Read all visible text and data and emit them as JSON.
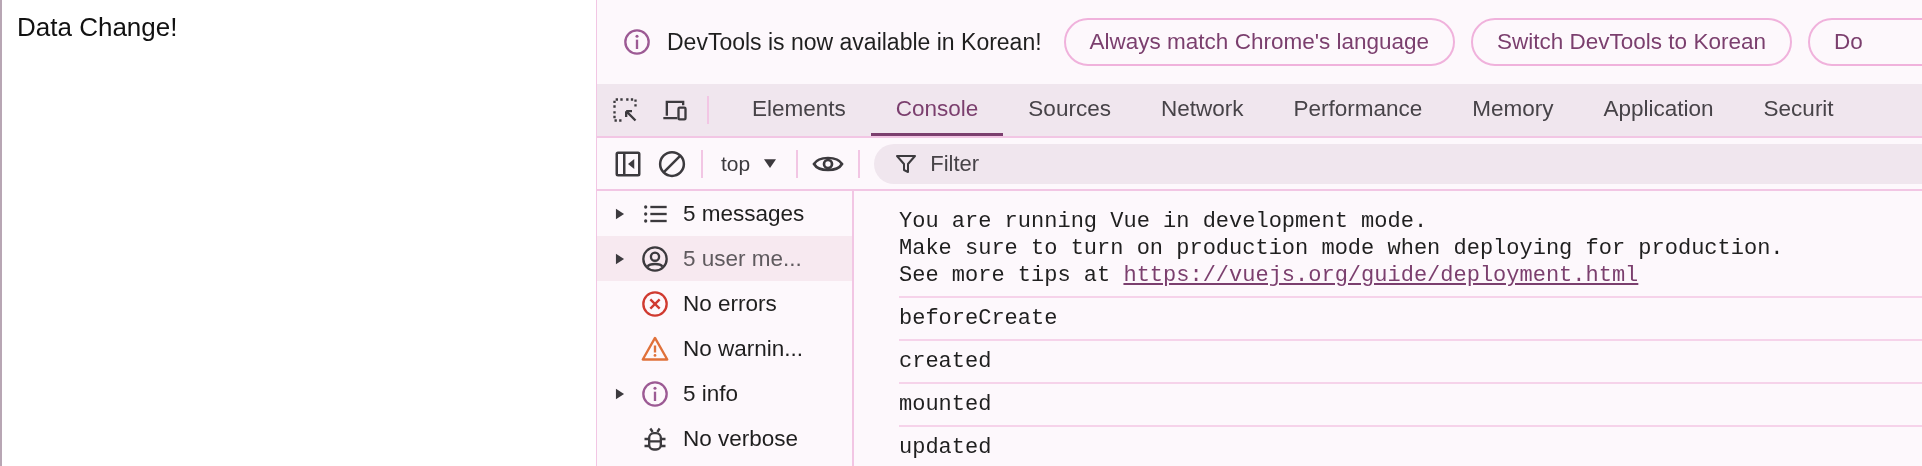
{
  "page": {
    "heading": "Data Change!"
  },
  "infobar": {
    "message": "DevTools is now available in Korean!",
    "buttons": [
      "Always match Chrome's language",
      "Switch DevTools to Korean",
      "Do"
    ]
  },
  "tabs": [
    {
      "label": "Elements",
      "selected": false
    },
    {
      "label": "Console",
      "selected": true
    },
    {
      "label": "Sources",
      "selected": false
    },
    {
      "label": "Network",
      "selected": false
    },
    {
      "label": "Performance",
      "selected": false
    },
    {
      "label": "Memory",
      "selected": false
    },
    {
      "label": "Application",
      "selected": false
    },
    {
      "label": "Securit",
      "selected": false
    }
  ],
  "toolbar": {
    "context": "top",
    "filter": {
      "placeholder": "Filter"
    }
  },
  "sidebar": {
    "items": [
      {
        "kind": "messages",
        "label": "5 messages",
        "expandable": true,
        "selected": false
      },
      {
        "kind": "user",
        "label": "5 user me...",
        "expandable": true,
        "selected": true
      },
      {
        "kind": "errors",
        "label": "No errors",
        "expandable": false,
        "selected": false
      },
      {
        "kind": "warnings",
        "label": "No warnin...",
        "expandable": false,
        "selected": false
      },
      {
        "kind": "info",
        "label": "5 info",
        "expandable": true,
        "selected": false
      },
      {
        "kind": "verbose",
        "label": "No verbose",
        "expandable": false,
        "selected": false
      }
    ]
  },
  "console": {
    "messages": [
      {
        "text": "You are running Vue in development mode.\nMake sure to turn on production mode when deploying for production.\nSee more tips at ",
        "link": "https://vuejs.org/guide/deployment.html"
      },
      {
        "text": "beforeCreate"
      },
      {
        "text": "created"
      },
      {
        "text": "mounted"
      },
      {
        "text": "updated"
      }
    ]
  }
}
